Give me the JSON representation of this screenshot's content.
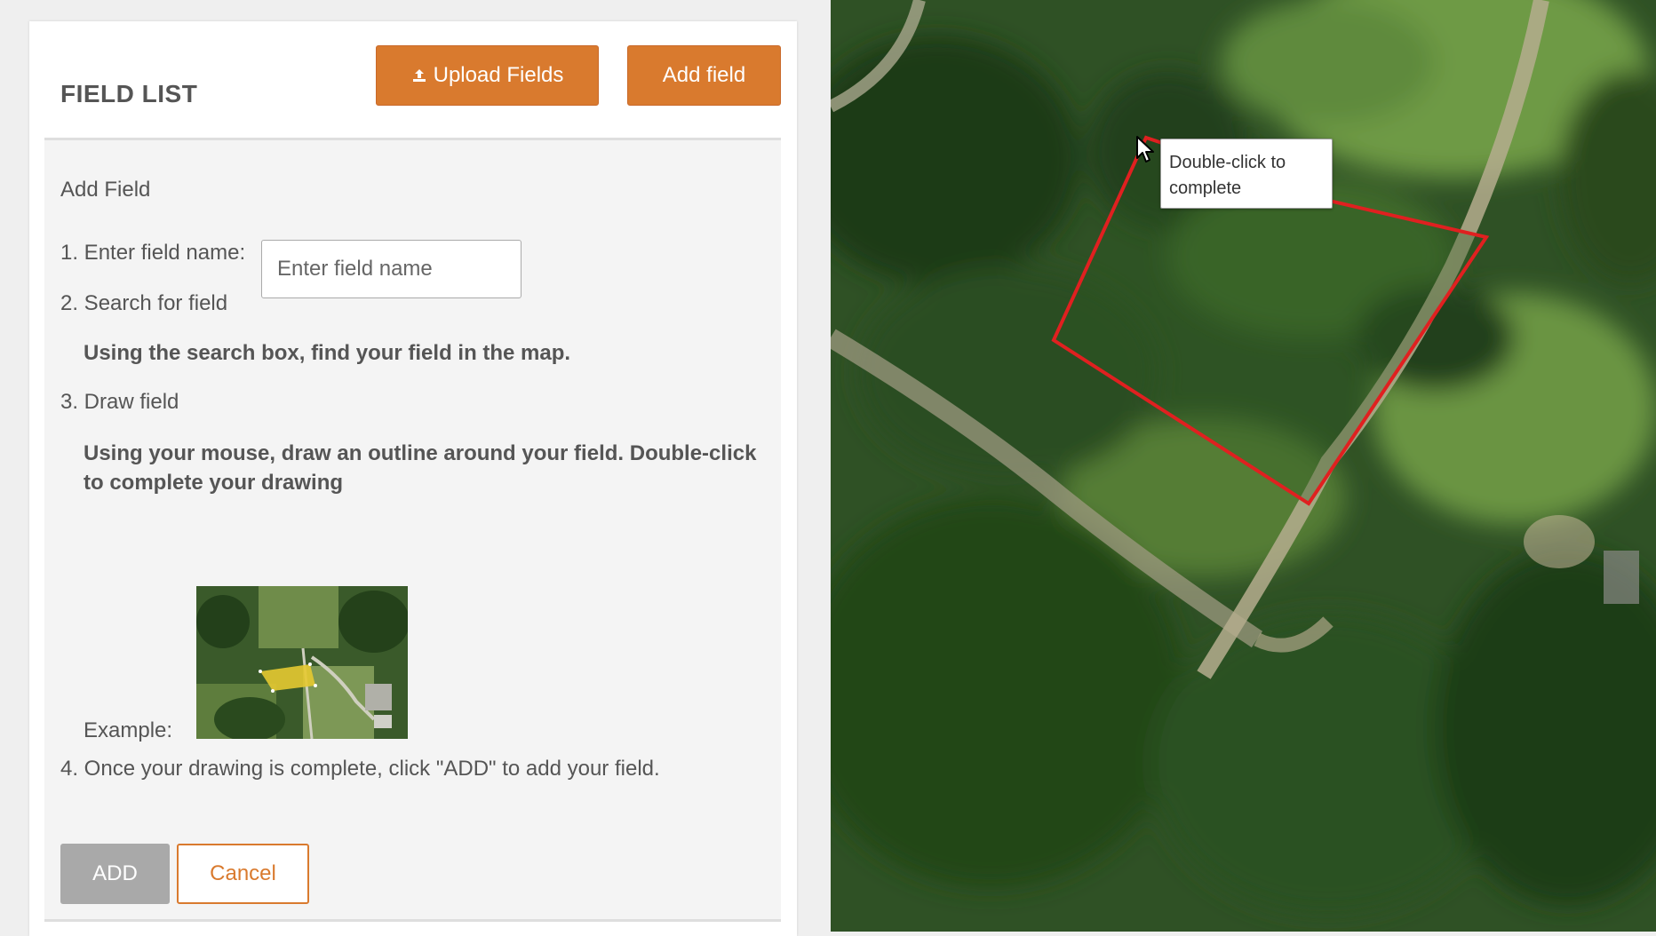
{
  "header": {
    "title": "FIELD LIST",
    "upload_label": "Upload Fields",
    "add_field_label": "Add field"
  },
  "form": {
    "heading": "Add Field",
    "step1_label": "1. Enter field name:",
    "name_placeholder": "Enter field name",
    "name_value": "",
    "step2_label": "2. Search for field",
    "step2_text": "Using the search box, find your field in the map.",
    "step3_label": "3. Draw field",
    "step3_text": "Using your mouse, draw an outline around your field. Double-click to complete your drawing",
    "example_label": "Example:",
    "step4_label": "4. Once your drawing is complete, click \"ADD\" to add your field.",
    "add_label": "ADD",
    "cancel_label": "Cancel"
  },
  "map": {
    "tooltip_line1": "Double-click to",
    "tooltip_line2": "complete",
    "polygon_color": "#e02020"
  },
  "colors": {
    "accent": "#d97a2e",
    "disabled": "#a9a9a9"
  },
  "icons": {
    "upload": "upload-icon",
    "cursor": "cursor-arrow-icon"
  }
}
